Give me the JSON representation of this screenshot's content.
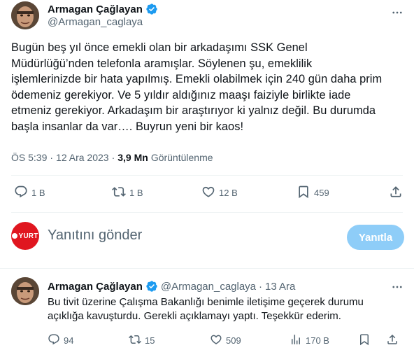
{
  "main_tweet": {
    "author": {
      "name": "Armagan Çağlayan",
      "handle": "@Armagan_caglaya"
    },
    "text": "Bugün beş yıl önce emekli olan bir arkadaşımı SSK Genel\nMüdürlüğü’nden telefonla aramışlar. Söylenen şu, emeklilik\nişlemlerinizde bir hata yapılmış. Emekli olabilmek için 240 gün daha prim\nödemeniz gerekiyor. Ve 5 yıldır aldığınız maaşı faiziyle birlikte iade\netmeniz gerekiyor. Arkadaşım bir araştırıyor ki yalnız değil. Bu durumda\nbaşla insanlar da var…. Buyrun yeni bir kaos!",
    "time": "ÖS 5:39",
    "separator": "·",
    "date": "12 Ara 2023",
    "views_count": "3,9 Mn",
    "views_label": "Görüntülenme",
    "stats": {
      "replies": "1 B",
      "reposts": "1 B",
      "likes": "12 B",
      "bookmarks": "459"
    }
  },
  "compose": {
    "placeholder": "Yanıtını gönder",
    "button_label": "Yanıtla",
    "avatar_text": "YURT"
  },
  "reply_tweet": {
    "author": {
      "name": "Armagan Çağlayan",
      "handle": "@Armagan_caglaya"
    },
    "separator": "·",
    "date": "13 Ara",
    "text": "Bu tivit üzerine Çalışma Bakanlığı benimle iletişime geçerek durumu\naçıklığa kavuşturdu. Gerekli açıklamayı yaptı. Teşekkür ederim.",
    "stats": {
      "replies": "94",
      "reposts": "15",
      "likes": "509",
      "views": "170 B"
    }
  },
  "colors": {
    "text_primary": "#0f1419",
    "text_secondary": "#536471",
    "verified": "#1d9bf0",
    "reply_button": "#8ecdf8",
    "yurt_red": "#e0161f"
  },
  "icons": {
    "verified": "verified-badge-icon",
    "more": "more-dots-icon",
    "reply": "reply-bubble-icon",
    "repost": "repost-arrows-icon",
    "like": "heart-icon",
    "bookmark": "bookmark-icon",
    "share": "share-upload-icon",
    "views": "bar-chart-icon"
  }
}
